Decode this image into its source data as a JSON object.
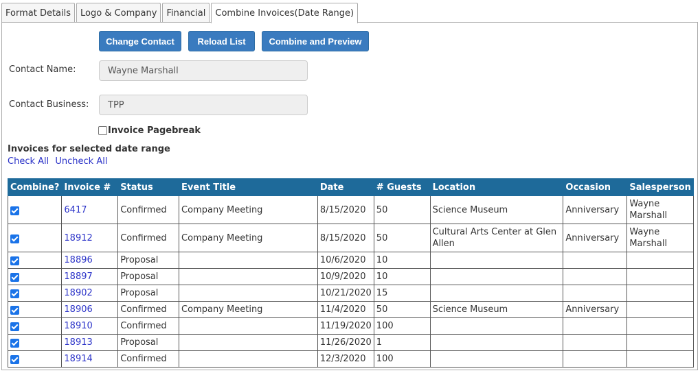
{
  "tabs": [
    "Format Details",
    "Logo & Company",
    "Financial",
    "Combine Invoices(Date Range)"
  ],
  "buttons": {
    "change_contact": "Change Contact",
    "reload_list": "Reload List",
    "combine_preview": "Combine and Preview"
  },
  "contact": {
    "name_label": "Contact Name:",
    "name_value": "Wayne Marshall",
    "business_label": "Contact Business:",
    "business_value": "TPP"
  },
  "pagebreak_label": "Invoice Pagebreak",
  "pagebreak_checked": false,
  "section_title": "Invoices for selected date range",
  "links": {
    "check_all": "Check All",
    "uncheck_all": "Uncheck All"
  },
  "table": {
    "headers": [
      "Combine?",
      "Invoice #",
      "Status",
      "Event Title",
      "Date",
      "# Guests",
      "Location",
      "Occasion",
      "Salesperson"
    ],
    "rows": [
      {
        "combine": true,
        "invoice": "6417",
        "status": "Confirmed",
        "event": "Company Meeting",
        "date": "8/15/2020",
        "guests": "50",
        "location": "Science Museum",
        "occasion": "Anniversary",
        "salesperson": "Wayne Marshall"
      },
      {
        "combine": true,
        "invoice": "18912",
        "status": "Confirmed",
        "event": "Company Meeting",
        "date": "8/15/2020",
        "guests": "50",
        "location": "Cultural Arts Center at Glen Allen",
        "occasion": "Anniversary",
        "salesperson": "Wayne Marshall"
      },
      {
        "combine": true,
        "invoice": "18896",
        "status": "Proposal",
        "event": "",
        "date": "10/6/2020",
        "guests": "10",
        "location": "",
        "occasion": "",
        "salesperson": ""
      },
      {
        "combine": true,
        "invoice": "18897",
        "status": "Proposal",
        "event": "",
        "date": "10/9/2020",
        "guests": "10",
        "location": "",
        "occasion": "",
        "salesperson": ""
      },
      {
        "combine": true,
        "invoice": "18902",
        "status": "Proposal",
        "event": "",
        "date": "10/21/2020",
        "guests": "15",
        "location": "",
        "occasion": "",
        "salesperson": ""
      },
      {
        "combine": true,
        "invoice": "18906",
        "status": "Confirmed",
        "event": "Company Meeting",
        "date": "11/4/2020",
        "guests": "50",
        "location": "Science Museum",
        "occasion": "Anniversary",
        "salesperson": ""
      },
      {
        "combine": true,
        "invoice": "18910",
        "status": "Confirmed",
        "event": "",
        "date": "11/19/2020",
        "guests": "100",
        "location": "",
        "occasion": "",
        "salesperson": ""
      },
      {
        "combine": true,
        "invoice": "18913",
        "status": "Proposal",
        "event": "",
        "date": "11/26/2020",
        "guests": "1",
        "location": "",
        "occasion": "",
        "salesperson": ""
      },
      {
        "combine": true,
        "invoice": "18914",
        "status": "Confirmed",
        "event": "",
        "date": "12/3/2020",
        "guests": "100",
        "location": "",
        "occasion": "",
        "salesperson": ""
      }
    ]
  },
  "colors": {
    "accent": "#3a7bbf",
    "header_bg": "#1e6a9a",
    "link": "#2a32c8"
  }
}
